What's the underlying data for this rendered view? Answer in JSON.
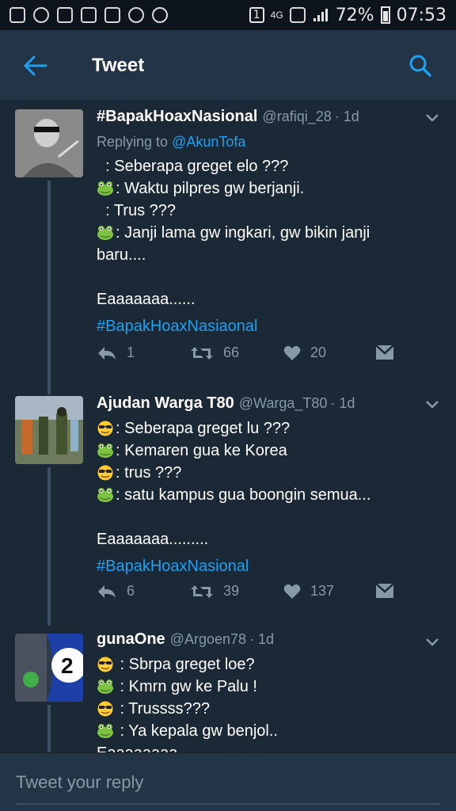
{
  "statusbar": {
    "sim": "1",
    "network": "4G",
    "battery": "72%",
    "time": "07:53"
  },
  "appbar": {
    "title": "Tweet",
    "back_icon": "arrow-left-icon",
    "search_icon": "search-icon"
  },
  "tweets": [
    {
      "name": "#BapakHoaxNasional",
      "handle": "@rafiqi_28",
      "time": "· 1d",
      "replying_prefix": "Replying to",
      "replying_to": "@AkunTofa",
      "lines": [
        {
          "emoji": "",
          "text": "  : Seberapa greget elo ???"
        },
        {
          "emoji": "frog",
          "text": ": Waktu pilpres gw berjanji."
        },
        {
          "emoji": "",
          "text": "  : Trus ???"
        },
        {
          "emoji": "frog",
          "text": ": Janji lama gw ingkari, gw bikin janji"
        },
        {
          "emoji": "",
          "text": "baru...."
        },
        {
          "emoji": "",
          "text": ""
        },
        {
          "emoji": "",
          "text": "Eaaaaaaa......"
        }
      ],
      "hashtag": "#BapakHoaxNasiaonal",
      "replies": "1",
      "retweets": "66",
      "likes": "20"
    },
    {
      "name": "Ajudan Warga T80",
      "handle": "@Warga_T80",
      "time": "· 1d",
      "lines": [
        {
          "emoji": "cool",
          "text": ": Seberapa greget lu ???"
        },
        {
          "emoji": "frog",
          "text": ": Kemaren gua ke Korea"
        },
        {
          "emoji": "cool",
          "text": ": trus ???"
        },
        {
          "emoji": "frog",
          "text": ": satu kampus gua boongin semua..."
        },
        {
          "emoji": "",
          "text": ""
        },
        {
          "emoji": "",
          "text": "Eaaaaaaa........."
        }
      ],
      "hashtag": "#BapakHoaxNasional",
      "replies": "6",
      "retweets": "39",
      "likes": "137"
    },
    {
      "name": "gunaOne",
      "handle": "@Argoen78",
      "time": "· 1d",
      "lines": [
        {
          "emoji": "cool",
          "text": " : Sbrpa greget loe?"
        },
        {
          "emoji": "frog",
          "text": " : Kmrn gw ke Palu !"
        },
        {
          "emoji": "cool",
          "text": " : Trussss???"
        },
        {
          "emoji": "frog",
          "text": " : Ya kepala gw benjol.."
        },
        {
          "emoji": "",
          "text": "Eaaaaaaaa"
        }
      ]
    }
  ],
  "reply": {
    "placeholder": "Tweet your reply"
  },
  "colors": {
    "background": "#1b2836",
    "appbar": "#243447",
    "accent": "#1da1f2",
    "muted": "#8899a6"
  }
}
